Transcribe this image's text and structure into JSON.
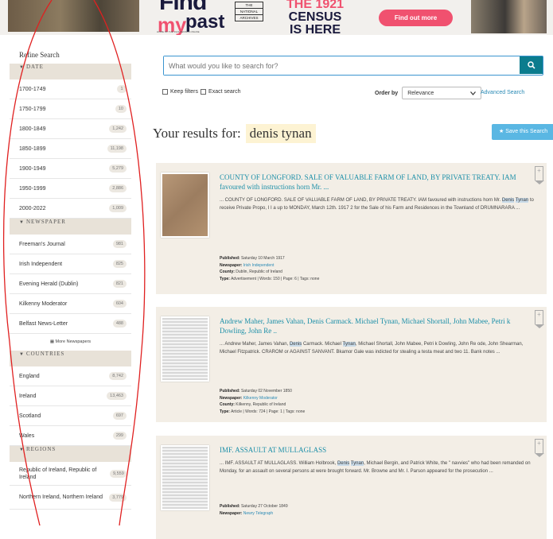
{
  "banner": {
    "logo_find": "Find",
    "logo_my": "my",
    "logo_past": "past",
    "logo_tagline": "HOME OF THE 1921 CENSUS ONLINE",
    "national_archives": [
      "THE",
      "NATIONAL",
      "ARCHIVES"
    ],
    "census_the": "THE 1921",
    "census_line1": "CENSUS",
    "census_line2": "IS HERE",
    "find_out_more": "Find out more"
  },
  "sidebar": {
    "refine_title": "Refine Search",
    "sections": [
      {
        "title": "DATE",
        "items": [
          {
            "label": "1700-1749",
            "count": "1"
          },
          {
            "label": "1750-1799",
            "count": "10"
          },
          {
            "label": "1800-1849",
            "count": "1,242"
          },
          {
            "label": "1850-1899",
            "count": "11,198"
          },
          {
            "label": "1900-1949",
            "count": "5,279"
          },
          {
            "label": "1950-1999",
            "count": "2,886"
          },
          {
            "label": "2000-2022",
            "count": "1,009"
          }
        ]
      },
      {
        "title": "NEWSPAPER",
        "items": [
          {
            "label": "Freeman's Journal",
            "count": "981"
          },
          {
            "label": "Irish Independent",
            "count": "825"
          },
          {
            "label": "Evening Herald (Dublin)",
            "count": "821"
          },
          {
            "label": "Kilkenny Moderator",
            "count": "604"
          },
          {
            "label": "Belfast News-Letter",
            "count": "488"
          }
        ],
        "more": "More Newspapers"
      },
      {
        "title": "COUNTRIES",
        "items": [
          {
            "label": "England",
            "count": "8,742"
          },
          {
            "label": "Ireland",
            "count": "13,463"
          },
          {
            "label": "Scotland",
            "count": "697"
          },
          {
            "label": "Wales",
            "count": "299"
          }
        ]
      },
      {
        "title": "REGIONS",
        "items": [
          {
            "label": "Republic of Ireland, Republic of Ireland",
            "count": "9,559"
          },
          {
            "label": "Northern Ireland, Northern Ireland",
            "count": "3,779"
          }
        ]
      }
    ]
  },
  "search": {
    "placeholder": "What would you like to search for?",
    "keep_filters": "Keep filters",
    "exact_search": "Exact search",
    "order_by_label": "Order by",
    "order_by_value": "Relevance",
    "advanced": "Advanced Search"
  },
  "results": {
    "heading": "Your results for:",
    "query": "denis tynan",
    "save_label": "Save this Search",
    "items": [
      {
        "title": "COUNTY OF LONGFORD. SALE OF VALUABLE FARM OF LAND, BY PRIVATE TREATY. IAM favoured with instructions horn Mr. ...",
        "snippet_pre": "... COUNTY OF LONGFORD. SALE OF VALUABLE FARM OF LAND, BY PRIVATE TREATY. IAM favoured with instructions horn Mr. ",
        "hl1": "Denis",
        "snippet_mid": " ",
        "hl2": "Tynan",
        "snippet_post": " to receive Private Propo, I I a up to MONDAY, March 12th. 1917 2 for the Sale of his Farm and Residences in the Townland of DRUMNARARA ...",
        "published": "Saturday 10 March 1917",
        "newspaper": "Irish Independent",
        "county": "Dublin, Republic of Ireland",
        "type_line": "Advertisement | Words: 150 | Page: 6 | Tags: none"
      },
      {
        "title": "Andrew Maher, James Vahan, Denis Carmack. Michael Tynan, Michael Shortall, John Mabee, Petri k Dowling, John Re ..",
        "snippet_pre": "... Andrew Maher, James Vahan, ",
        "hl1": "Denis",
        "snippet_mid": " Carmack. Michael ",
        "hl2": "Tynan",
        "snippet_post": ", Michael Shortall, John Mabee, Petri k Dowling, John Re ode, John Shearman, Michael Fitzpatrick. CRAROM or AGAINST SANVANT. Bkamor Gale was indicted for stealing a testa meat and two 11. Bank notes ...",
        "published": "Saturday 02 November 1850",
        "newspaper": "Kilkenny Moderator",
        "county": "Kilkenny, Republic of Ireland",
        "type_line": "Article | Words: 724 | Page: 1 | Tags: none"
      },
      {
        "title": "IMF. ASSAULT AT MULLAGLASS",
        "snippet_pre": "... IMF. ASSAULT AT MULLAGLASS. William Holbrook, ",
        "hl1": "Denis",
        "snippet_mid": " ",
        "hl2": "Tynan",
        "snippet_post": ", Michael Bergin, and Patrick White, the \" navvies\" who had been remanded on Monday, for an assault on several persons at were brought forward. Mr. Browne and Mr. I. Parson appeared for the prosecution ...",
        "published": "Saturday 27 October 1849",
        "newspaper": "Newry Telegraph"
      }
    ]
  },
  "labels": {
    "published": "Published:",
    "newspaper": "Newspaper:",
    "county": "County:",
    "type": "Type:"
  },
  "colors": {
    "accent": "#0b7c8e",
    "link": "#1c8fa8",
    "pink": "#f0516f",
    "annotation": "#e02020"
  }
}
